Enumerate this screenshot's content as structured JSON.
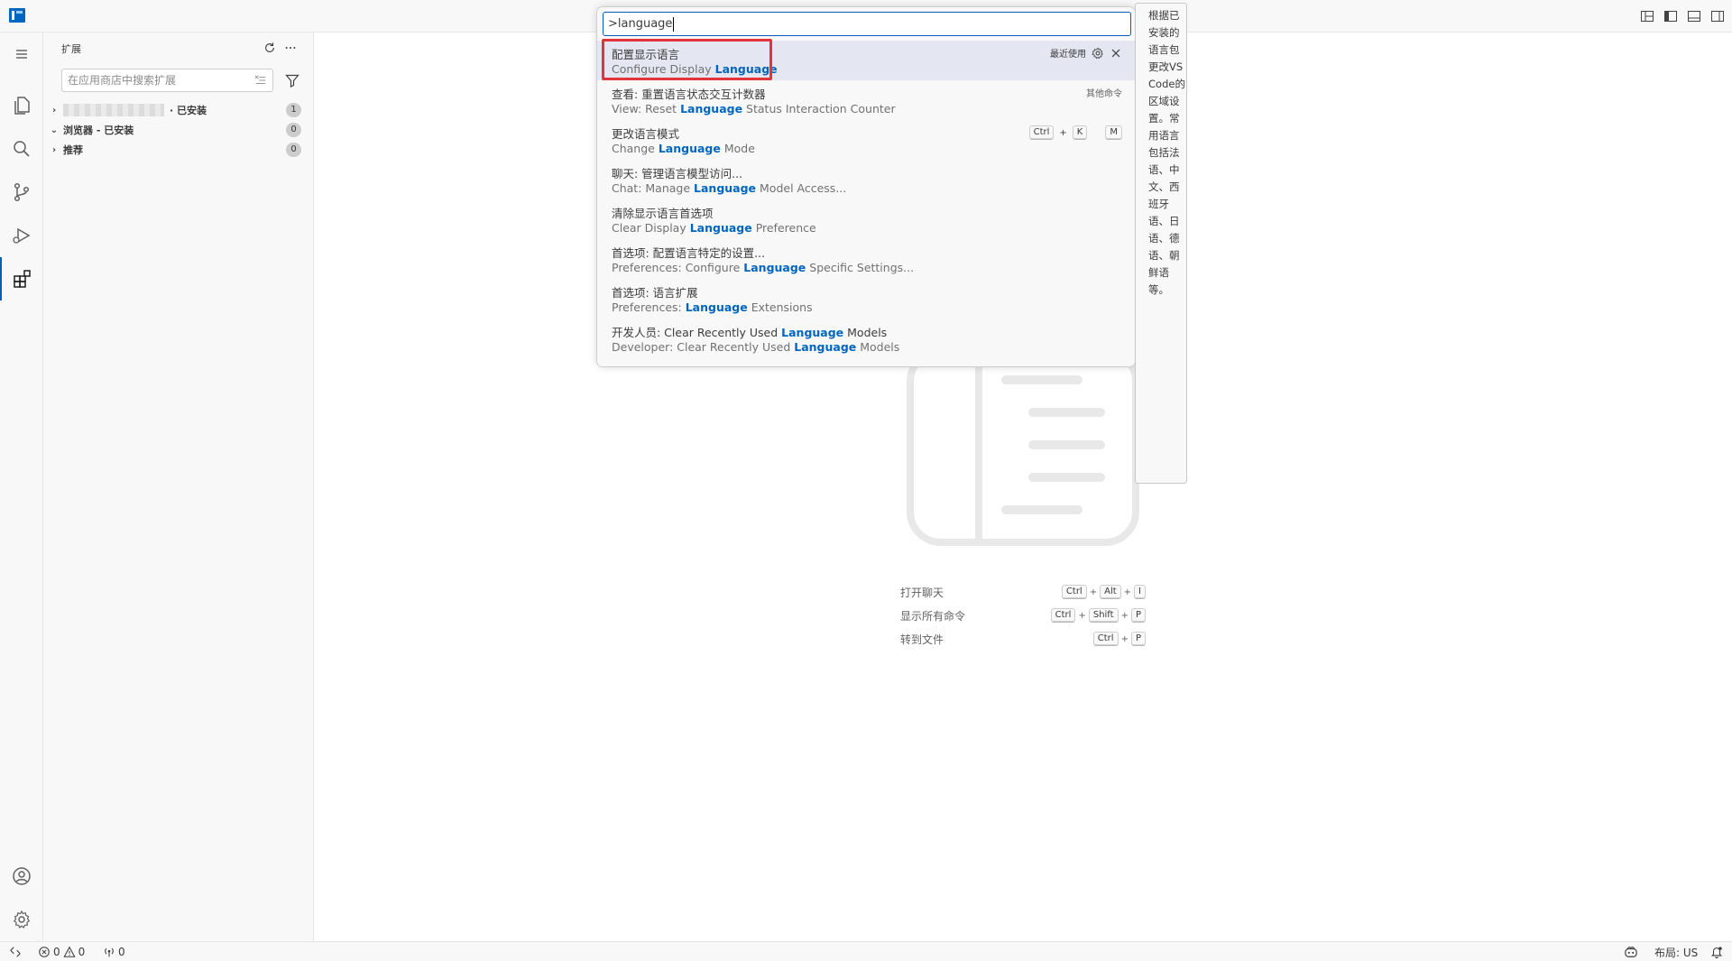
{
  "colors": {
    "accent": "#005fb8",
    "highlight_border": "#e3343c",
    "match_text": "#0066bf"
  },
  "sidebar": {
    "title": "扩展",
    "search_placeholder": "在应用商店中搜索扩展",
    "sections": [
      {
        "label": "· 已安装",
        "count": "1"
      },
      {
        "label": "浏览器 - 已安装",
        "count": "0"
      },
      {
        "label": "推荐",
        "count": "0"
      }
    ]
  },
  "palette": {
    "input_value": ">language",
    "items": [
      {
        "main": "配置显示语言",
        "sub_pre": "Configure Display ",
        "sub_match": "Language",
        "sub_post": "",
        "right_label": "最近使用"
      },
      {
        "main": "查看: 重置语言状态交互计数器",
        "sub_pre": "View: Reset ",
        "sub_match": "Language",
        "sub_post": " Status Interaction Counter",
        "right_label": "其他命令"
      },
      {
        "main": "更改语言模式",
        "sub_pre": "Change ",
        "sub_match": "Language",
        "sub_post": " Mode",
        "keys": [
          "Ctrl",
          "+",
          "K",
          "M"
        ]
      },
      {
        "main": "聊天: 管理语言模型访问...",
        "sub_pre": "Chat: Manage ",
        "sub_match": "Language",
        "sub_post": " Model Access..."
      },
      {
        "main": "清除显示语言首选项",
        "sub_pre": "Clear Display ",
        "sub_match": "Language",
        "sub_post": " Preference"
      },
      {
        "main": "首选项: 配置语言特定的设置...",
        "sub_pre": "Preferences: Configure ",
        "sub_match": "Language",
        "sub_post": " Specific Settings..."
      },
      {
        "main": "首选项: 语言扩展",
        "sub_pre": "Preferences: ",
        "sub_match": "Language",
        "sub_post": " Extensions"
      },
      {
        "main_pre": "开发人员: Clear Recently Used ",
        "main_match": "Language",
        "main_post": " Models",
        "sub_pre": "Developer: Clear Recently Used ",
        "sub_match": "Language",
        "sub_post": " Models"
      }
    ]
  },
  "tooltip": {
    "text": "根据已安装的语言包更改VS Code的区域设置。常用语言包括法语、中文、西班牙语、日语、德语、朝鲜语等。"
  },
  "shortcuts": [
    {
      "label": "打开聊天",
      "keys": [
        "Ctrl",
        "+",
        "Alt",
        "+",
        "I"
      ]
    },
    {
      "label": "显示所有命令",
      "keys": [
        "Ctrl",
        "+",
        "Shift",
        "+",
        "P"
      ]
    },
    {
      "label": "转到文件",
      "keys": [
        "Ctrl",
        "+",
        "P"
      ]
    }
  ],
  "statusbar": {
    "errors": "0",
    "warnings": "0",
    "ports": "0",
    "layout": "布局: US"
  }
}
